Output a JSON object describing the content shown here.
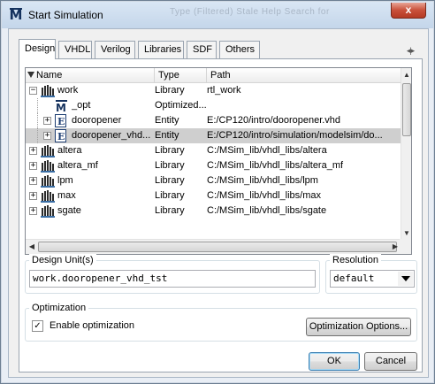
{
  "window": {
    "title": "Start Simulation",
    "ghost_menu_text": "Type (Filtered)    Stale    Help    Search for",
    "close_label": "x"
  },
  "tabs": [
    {
      "label": "Design",
      "active": true
    },
    {
      "label": "VHDL",
      "active": false
    },
    {
      "label": "Verilog",
      "active": false
    },
    {
      "label": "Libraries",
      "active": false
    },
    {
      "label": "SDF",
      "active": false
    },
    {
      "label": "Others",
      "active": false
    }
  ],
  "tab_scroll_label": "◂|▸",
  "tree": {
    "columns": {
      "name": "Name",
      "type": "Type",
      "path": "Path"
    },
    "rows": [
      {
        "expander": "−",
        "level": 0,
        "icon": "library-icon",
        "name": "work",
        "type": "Library",
        "path": "rtl_work",
        "selected": false
      },
      {
        "expander": "",
        "level": 1,
        "icon": "optimized-design-icon",
        "name": "_opt",
        "type": "Optimized...",
        "path": "",
        "selected": false
      },
      {
        "expander": "+",
        "level": 1,
        "icon": "entity-icon",
        "name": "dooropener",
        "type": "Entity",
        "path": "E:/CP120/intro/dooropener.vhd",
        "selected": false
      },
      {
        "expander": "+",
        "level": 1,
        "icon": "entity-icon",
        "name": "dooropener_vhd...",
        "type": "Entity",
        "path": "E:/CP120/intro/simulation/modelsim/do...",
        "selected": true
      },
      {
        "expander": "+",
        "level": 0,
        "icon": "library-icon",
        "name": "altera",
        "type": "Library",
        "path": "C:/MSim_lib/vhdl_libs/altera",
        "selected": false
      },
      {
        "expander": "+",
        "level": 0,
        "icon": "library-icon",
        "name": "altera_mf",
        "type": "Library",
        "path": "C:/MSim_lib/vhdl_libs/altera_mf",
        "selected": false
      },
      {
        "expander": "+",
        "level": 0,
        "icon": "library-icon",
        "name": "lpm",
        "type": "Library",
        "path": "C:/MSim_lib/vhdl_libs/lpm",
        "selected": false
      },
      {
        "expander": "+",
        "level": 0,
        "icon": "library-icon",
        "name": "max",
        "type": "Library",
        "path": "C:/MSim_lib/vhdl_libs/max",
        "selected": false
      },
      {
        "expander": "+",
        "level": 0,
        "icon": "library-icon",
        "name": "sgate",
        "type": "Library",
        "path": "C:/MSim_lib/vhdl_libs/sgate",
        "selected": false
      }
    ]
  },
  "design_unit": {
    "label": "Design Unit(s)",
    "value": "work.dooropener_vhd_tst"
  },
  "resolution": {
    "label": "Resolution",
    "value": "default"
  },
  "optimization": {
    "label": "Optimization",
    "enable_label": "Enable optimization",
    "enabled": true,
    "options_button": "Optimization Options..."
  },
  "buttons": {
    "ok": "OK",
    "cancel": "Cancel"
  },
  "colors": {
    "selected_row": "#cfcfcf",
    "title_icon": "#15325e",
    "close": "#c9503a"
  }
}
